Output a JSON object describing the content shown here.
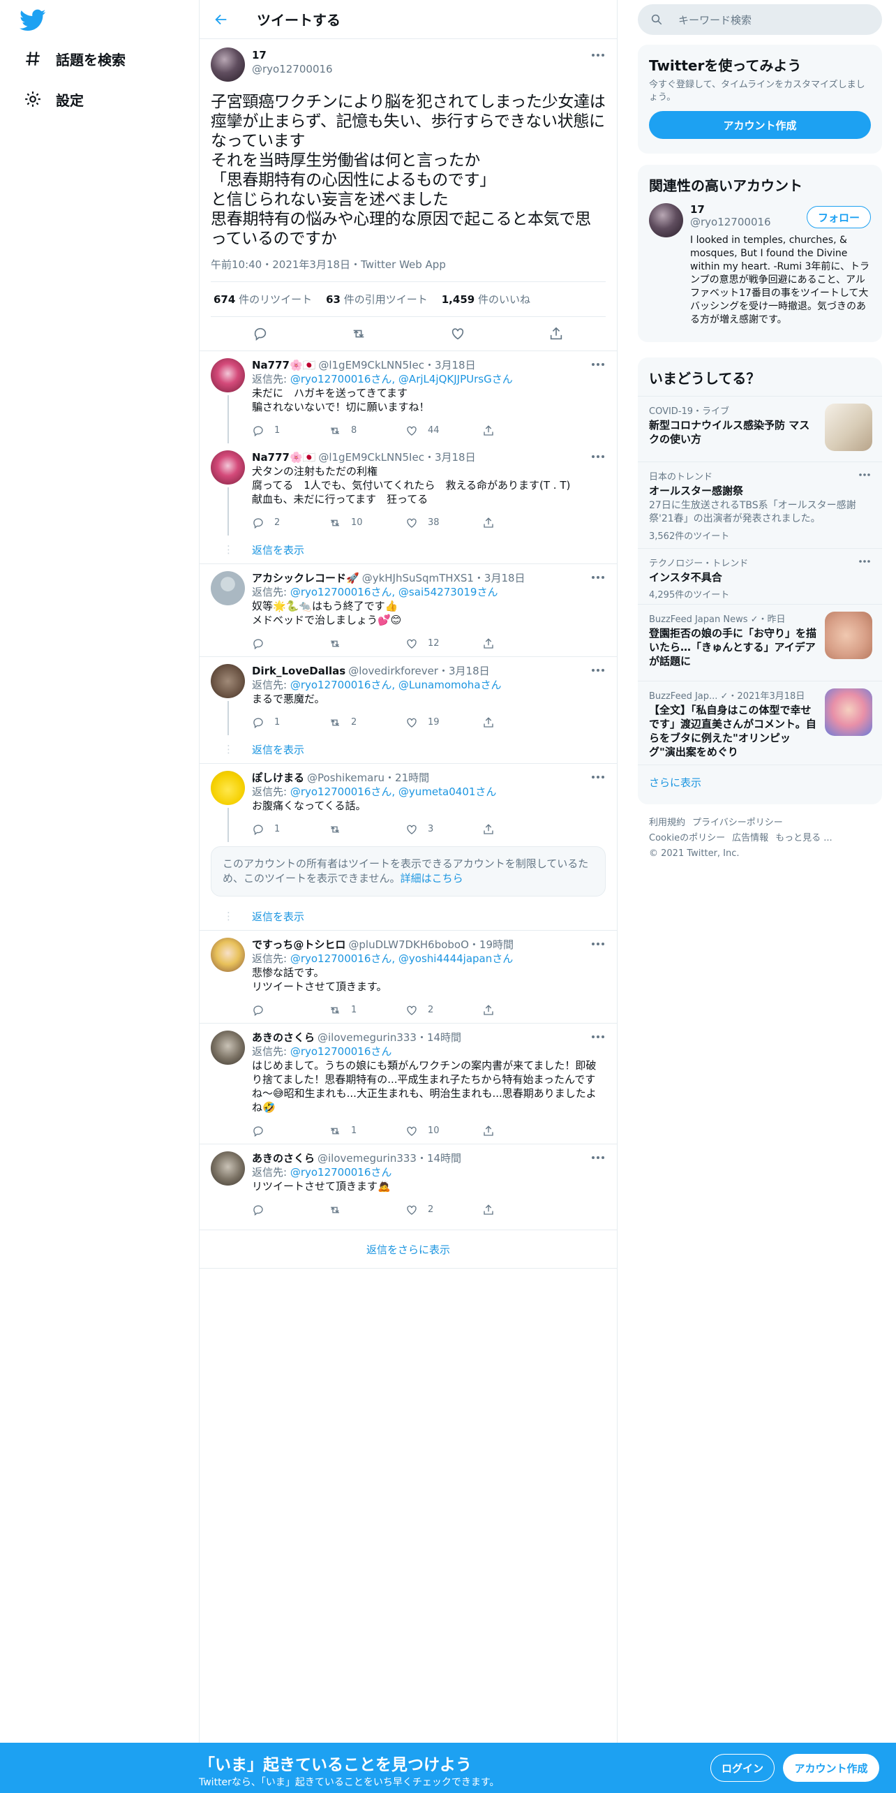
{
  "nav": {
    "explore": "話題を検索",
    "settings": "設定"
  },
  "header": {
    "title": "ツイートする"
  },
  "main_tweet": {
    "name": "17",
    "handle": "@ryo12700016",
    "text": "子宮頸癌ワクチンにより脳を犯されてしまった少女達は痙攣が止まらず、記憶も失い、歩行すらできない状態になっています\nそれを当時厚生労働省は何と言ったか\n「思春期特有の心因性によるものです」\nと信じられない妄言を述べました\n思春期特有の悩みや心理的な原因で起こると本気で思っているのですか",
    "meta": "午前10:40・2021年3月18日・Twitter Web App",
    "retweets_num": "674",
    "retweets_label": " 件のリツイート",
    "quotes_num": "63",
    "quotes_label": " 件の引用ツイート",
    "likes_num": "1,459",
    "likes_label": " 件のいいね"
  },
  "replies": [
    {
      "name": "Na777🌸🇯🇵",
      "handle": "@l1gEM9CkLNN5Iec・3月18日",
      "to_prefix": "返信先: ",
      "to_links": "@ryo12700016さん, @ArjL4jQKJJPUrsGさん",
      "text": "未だに　ハガキを送ってきてます\n騙されないないで！切に願いますね！",
      "replies": "1",
      "retweets": "8",
      "likes": "44"
    },
    {
      "name": "Na777🌸🇯🇵",
      "handle": "@l1gEM9CkLNN5Iec・3月18日",
      "text": "犬タンの注射もただの利権\n腐ってる　1人でも、気付いてくれたら　救える命があります(T . T)\n献血も、未だに行ってます　狂ってる",
      "replies": "2",
      "retweets": "10",
      "likes": "38"
    },
    {
      "name": "アカシックレコード🚀",
      "handle": "@ykHJhSuSqmTHXS1・3月18日",
      "to_prefix": "返信先: ",
      "to_links": "@ryo12700016さん, @sai54273019さん",
      "text": "奴等🌟🐍🐀はもう終了です👍\nメドベッドで治しましょう💕😊",
      "replies": "",
      "retweets": "",
      "likes": "12"
    },
    {
      "name": "Dirk_LoveDallas",
      "handle": "@lovedirkforever・3月18日",
      "to_prefix": "返信先: ",
      "to_links": "@ryo12700016さん, @Lunamomohaさん",
      "text": "まるで悪魔だ。",
      "replies": "1",
      "retweets": "2",
      "likes": "19"
    },
    {
      "name": "ぽしけまる",
      "handle": "@Poshikemaru・21時間",
      "to_prefix": "返信先: ",
      "to_links": "@ryo12700016さん, @yumeta0401さん",
      "text": "お腹痛くなってくる話。",
      "replies": "1",
      "retweets": "",
      "likes": "3"
    },
    {
      "name": "ですっち@トシヒロ",
      "handle": "@pluDLW7DKH6boboO・19時間",
      "to_prefix": "返信先: ",
      "to_links": "@ryo12700016さん, @yoshi4444japanさん",
      "text": "悲惨な話です。\nリツイートさせて頂きます。",
      "replies": "",
      "retweets": "1",
      "likes": "2"
    },
    {
      "name": "あきのさくら",
      "handle": "@ilovemegurin333・14時間",
      "to_prefix": "返信先: ",
      "to_links": "@ryo12700016さん",
      "text": "はじめまして。うちの娘にも類がんワクチンの案内書が来てました！即破り捨てました！思春期特有の...平成生まれ子たちから特有始まったんですね〜😅昭和生まれも...大正生まれも、明治生まれも...思春期ありましたよね🤣",
      "replies": "",
      "retweets": "1",
      "likes": "10"
    },
    {
      "name": "あきのさくら",
      "handle": "@ilovemegurin333・14時間",
      "to_prefix": "返信先: ",
      "to_links": "@ryo12700016さん",
      "text": "リツイートさせて頂きます🙇",
      "replies": "",
      "retweets": "",
      "likes": "2"
    }
  ],
  "show_replies": "返信を表示",
  "restricted": {
    "text": "このアカウントの所有者はツイートを表示できるアカウントを制限しているため、このツイートを表示できません。",
    "link": "詳細はこちら"
  },
  "more_replies": "返信をさらに表示",
  "search": {
    "placeholder": "キーワード検索"
  },
  "signup_card": {
    "title": "Twitterを使ってみよう",
    "desc": "今すぐ登録して、タイムラインをカスタマイズしましょう。",
    "button": "アカウント作成"
  },
  "related": {
    "title": "関連性の高いアカウント",
    "name": "17",
    "handle": "@ryo12700016",
    "follow": "フォロー",
    "bio": "I looked in temples, churches, & mosques, But I found the Divine within my heart. -Rumi 3年前に、トランプの意思が戦争回避にあること、アルファベット17番目の事をツイートして大バッシングを受け一時撤退。気づきのある方が増え感謝です。"
  },
  "trends": {
    "title": "いまどうしてる？",
    "items": [
      {
        "ctx": "COVID-19・ライブ",
        "title": "新型コロナウイルス感染予防 マスクの使い方",
        "desc": "",
        "count": ""
      },
      {
        "ctx": "日本のトレンド",
        "title": "オールスター感謝祭",
        "desc": "27日に生放送されるTBS系「オールスター感謝祭'21春」の出演者が発表されました。",
        "count": "3,562件のツイート"
      },
      {
        "ctx": "テクノロジー・トレンド",
        "title": "インスタ不具合",
        "desc": "",
        "count": "4,295件のツイート"
      },
      {
        "ctx": "BuzzFeed Japan News ✓・昨日",
        "title": "登園拒否の娘の手に「お守り」を描いたら…「きゅんとする」アイデアが話題に",
        "desc": "",
        "count": ""
      },
      {
        "ctx": "BuzzFeed Jap... ✓・2021年3月18日",
        "title": "【全文】「私自身はこの体型で幸せです」渡辺直美さんがコメント。自らをブタに例えた\"オリンピッグ\"演出案をめぐり",
        "desc": "",
        "count": ""
      }
    ],
    "show_more": "さらに表示"
  },
  "footer": {
    "terms": "利用規約",
    "privacy": "プライバシーポリシー",
    "cookie": "Cookieのポリシー",
    "ads": "広告情報",
    "more": "もっと見る ...",
    "copyright": "© 2021 Twitter, Inc."
  },
  "bottom_bar": {
    "title": "「いま」起きていることを見つけよう",
    "subtitle": "Twitterなら、「いま」起きていることをいち早くチェックできます。",
    "login": "ログイン",
    "signup": "アカウント作成"
  },
  "colors": {
    "accent": "#1da1f2",
    "link": "#1b95e0",
    "like": "#657786"
  }
}
